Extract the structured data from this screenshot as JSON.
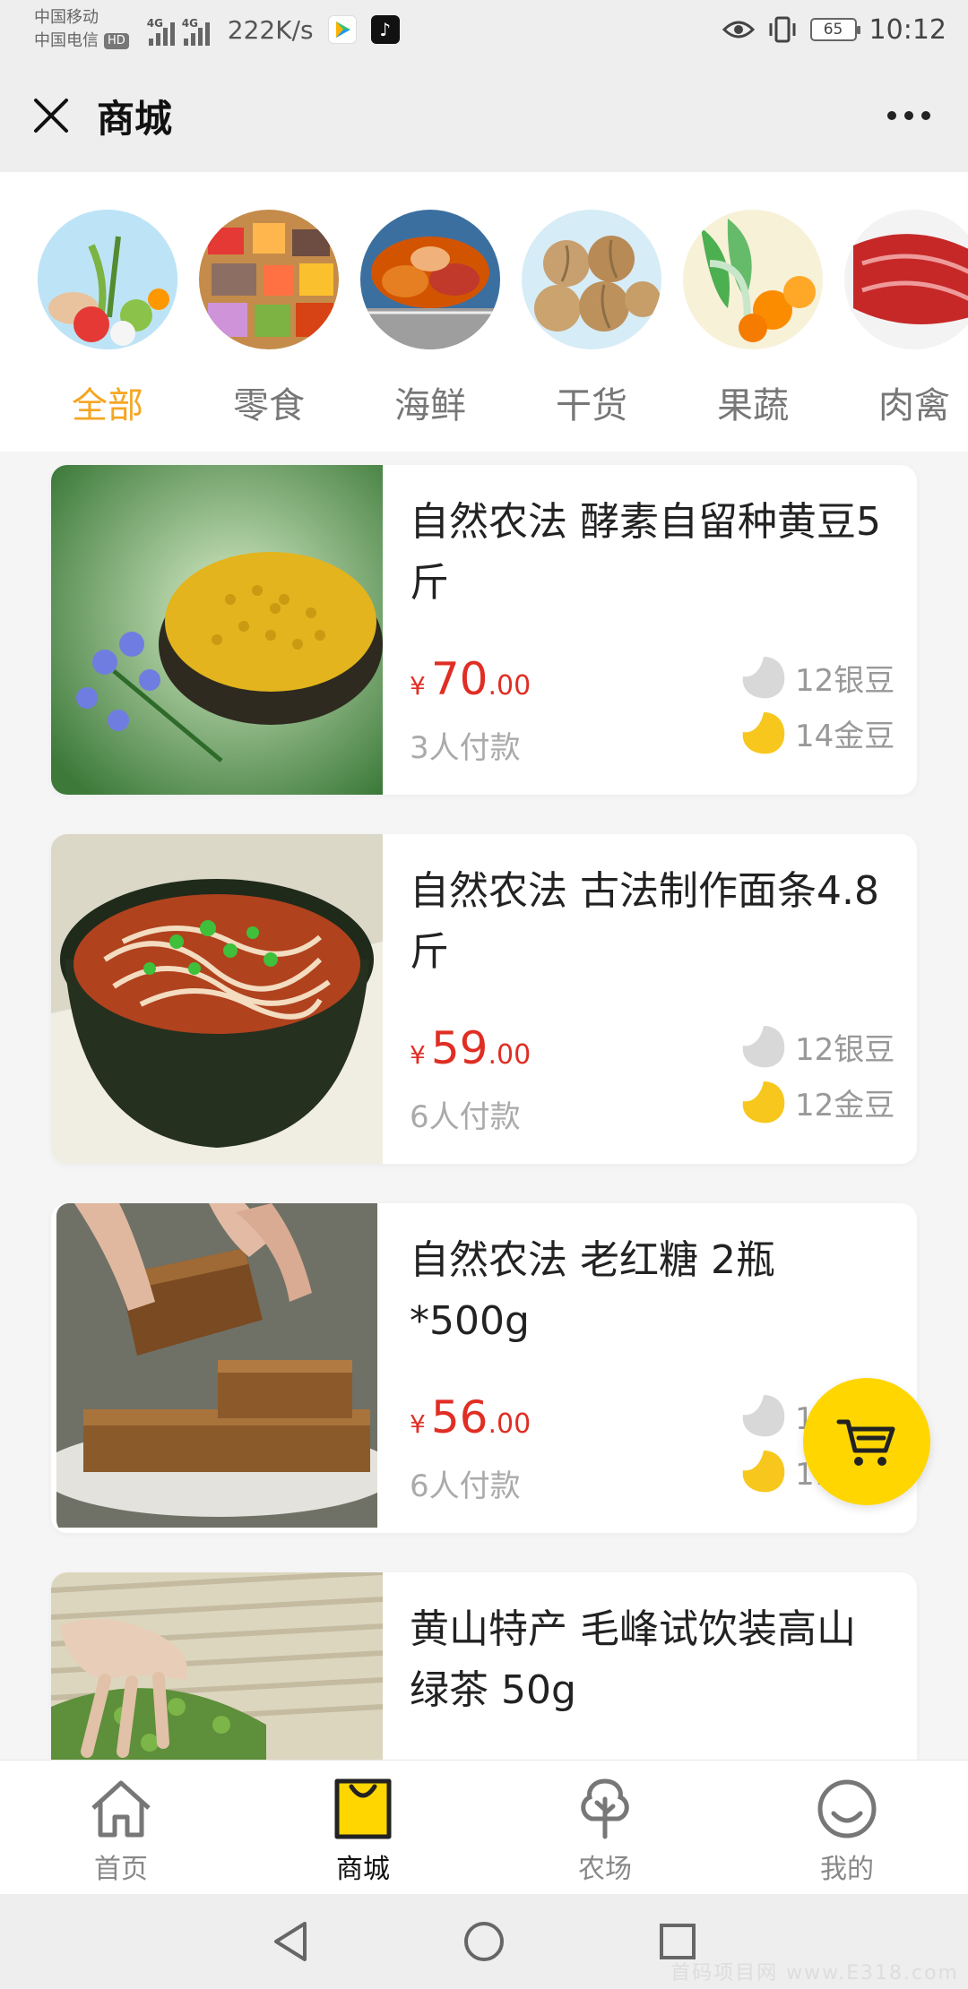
{
  "status_bar": {
    "carrier_1": "中国移动",
    "carrier_2": "中国电信",
    "hd": "HD",
    "net_type": "4G",
    "net_speed": "222K/s",
    "battery": "65",
    "time": "10:12"
  },
  "header": {
    "title": "商城"
  },
  "categories": [
    {
      "label": "全部",
      "active": true
    },
    {
      "label": "零食",
      "active": false
    },
    {
      "label": "海鲜",
      "active": false
    },
    {
      "label": "干货",
      "active": false
    },
    {
      "label": "果蔬",
      "active": false
    },
    {
      "label": "肉禽",
      "active": false
    }
  ],
  "products": [
    {
      "name": "自然农法 酵素自留种黄豆5斤",
      "currency": "¥",
      "price_int": "70",
      "price_dec": ".00",
      "sold": "3人付款",
      "silver": "12银豆",
      "gold": "14金豆"
    },
    {
      "name": "自然农法 古法制作面条4.8斤",
      "currency": "¥",
      "price_int": "59",
      "price_dec": ".00",
      "sold": "6人付款",
      "silver": "12银豆",
      "gold": "12金豆"
    },
    {
      "name": "自然农法 老红糖 2瓶*500g",
      "currency": "¥",
      "price_int": "56",
      "price_dec": ".00",
      "sold": "6人付款",
      "silver": "12银豆",
      "gold": "11金豆"
    },
    {
      "name": "黄山特产 毛峰试饮装高山绿茶 50g",
      "currency": "",
      "price_int": "",
      "price_dec": "",
      "sold": "",
      "silver": "",
      "gold": ""
    }
  ],
  "tabbar": [
    {
      "label": "首页",
      "icon": "home-icon",
      "active": false
    },
    {
      "label": "商城",
      "icon": "shopping-bag-icon",
      "active": true
    },
    {
      "label": "农场",
      "icon": "tree-icon",
      "active": false
    },
    {
      "label": "我的",
      "icon": "profile-icon",
      "active": false
    }
  ],
  "colors": {
    "accent": "#f5a623",
    "price": "#e02e24",
    "cart": "#ffd600"
  },
  "watermark": "首码项目网 www.E318.com"
}
